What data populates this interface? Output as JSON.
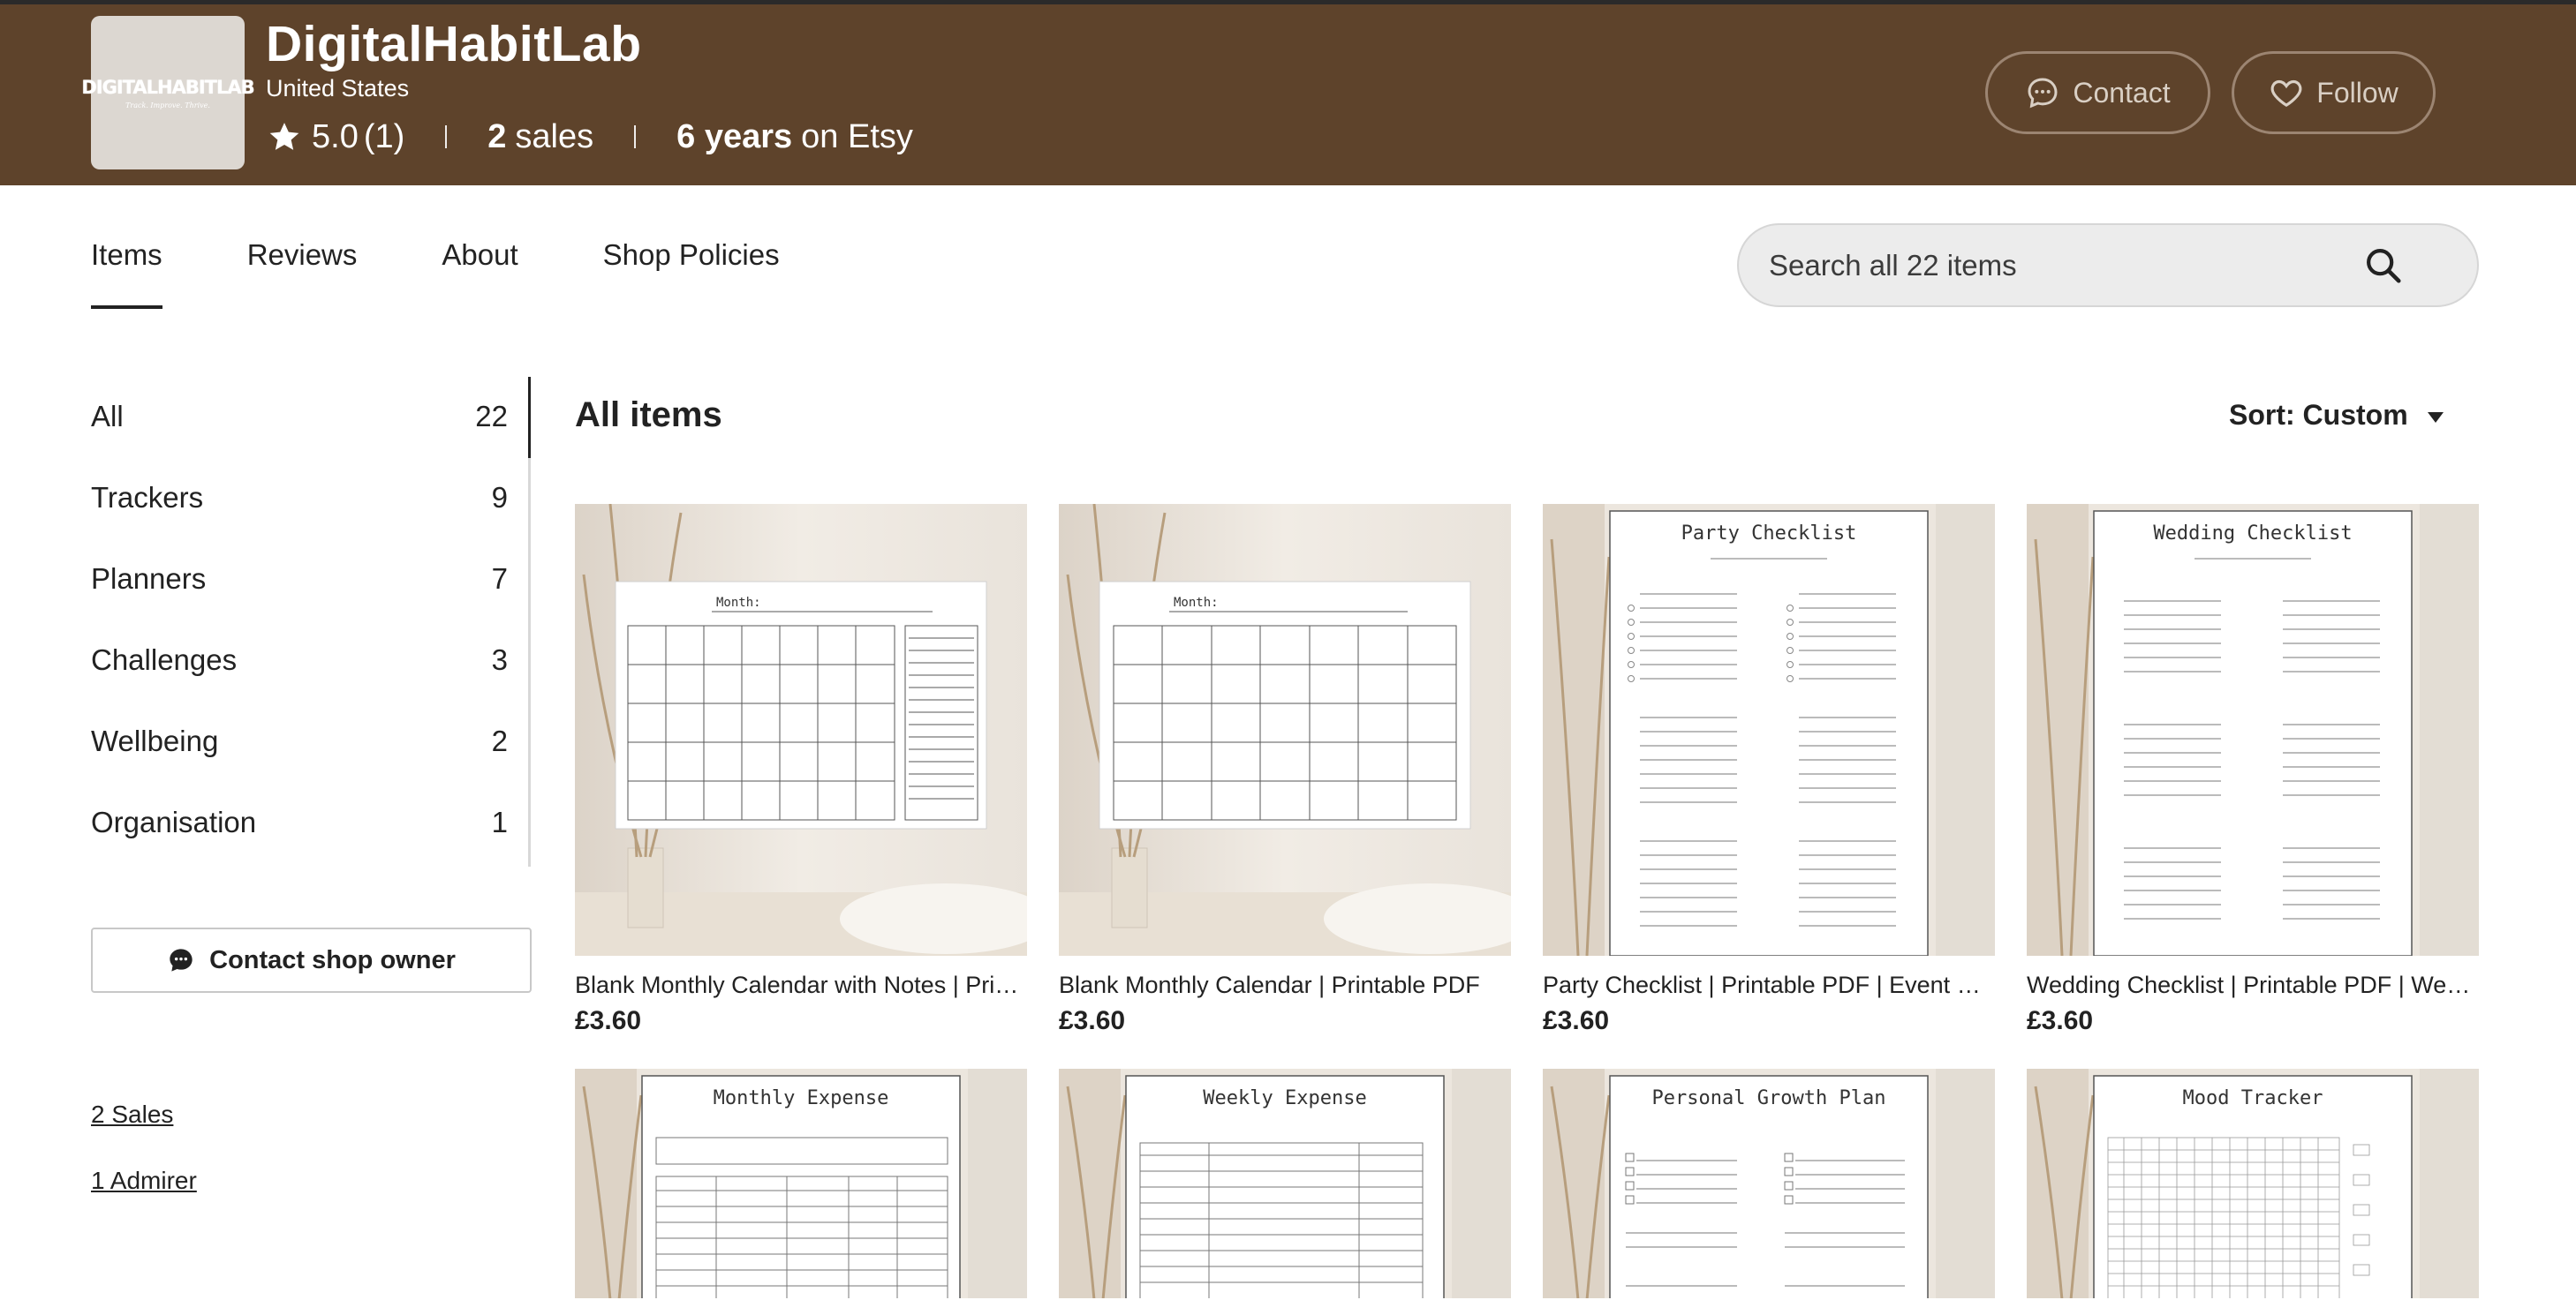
{
  "shop": {
    "name": "DigitalHabitLab",
    "logo_text": "DIGITALHABITLAB",
    "logo_sub": "Track. Improve. Thrive.",
    "location": "United States",
    "rating": "5.0",
    "rating_count": "(1)",
    "sales_count": "2",
    "sales_label": "sales",
    "years": "6 years",
    "years_suffix": "on Etsy"
  },
  "header_buttons": {
    "contact": "Contact",
    "follow": "Follow"
  },
  "tabs": [
    {
      "label": "Items"
    },
    {
      "label": "Reviews"
    },
    {
      "label": "About"
    },
    {
      "label": "Shop Policies"
    }
  ],
  "search": {
    "placeholder": "Search all 22 items"
  },
  "sidebar": {
    "categories": [
      {
        "label": "All",
        "count": "22"
      },
      {
        "label": "Trackers",
        "count": "9"
      },
      {
        "label": "Planners",
        "count": "7"
      },
      {
        "label": "Challenges",
        "count": "3"
      },
      {
        "label": "Wellbeing",
        "count": "2"
      },
      {
        "label": "Organisation",
        "count": "1"
      }
    ],
    "contact_owner": "Contact shop owner",
    "sales_link": "2 Sales",
    "admirer_link": "1 Admirer"
  },
  "main": {
    "title": "All items",
    "sort_label": "Sort: Custom",
    "items": [
      {
        "title": "Blank Monthly Calendar with Notes | Printable PDF",
        "price": "£3.60",
        "image_heading": "Month:"
      },
      {
        "title": "Blank Monthly Calendar | Printable PDF",
        "price": "£3.60",
        "image_heading": "Month:"
      },
      {
        "title": "Party Checklist | Printable PDF | Event Planner",
        "price": "£3.60",
        "image_heading": "Party Checklist"
      },
      {
        "title": "Wedding Checklist | Printable PDF | Wedding Planner",
        "price": "£3.60",
        "image_heading": "Wedding Checklist"
      },
      {
        "title": "",
        "price": "",
        "image_heading": "Monthly Expense"
      },
      {
        "title": "",
        "price": "",
        "image_heading": "Weekly Expense"
      },
      {
        "title": "",
        "price": "",
        "image_heading": "Personal Growth Plan"
      },
      {
        "title": "",
        "price": "",
        "image_heading": "Mood Tracker"
      }
    ]
  },
  "colors": {
    "header_bg": "#5e432b",
    "text": "#222222"
  }
}
